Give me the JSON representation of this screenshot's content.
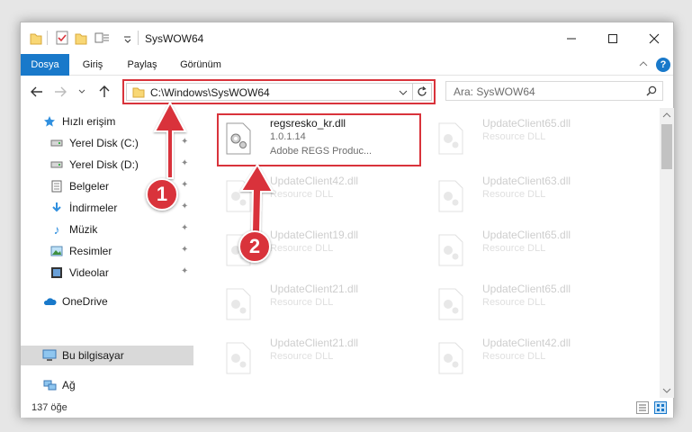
{
  "window": {
    "title": "SysWOW64",
    "minimize_icon": "minimize-icon",
    "maximize_icon": "maximize-icon",
    "close_icon": "close-icon"
  },
  "ribbon": {
    "tabs": [
      "Dosya",
      "Giriş",
      "Paylaş",
      "Görünüm"
    ],
    "active_tab_color": "#1979ca"
  },
  "nav": {
    "address": "C:\\Windows\\SysWOW64",
    "search_placeholder": "Ara: SysWOW64"
  },
  "sidebar": {
    "items": [
      {
        "label": "Hızlı erişim",
        "icon": "star-icon",
        "pinned": false
      },
      {
        "label": "Yerel Disk (C:)",
        "icon": "drive-icon",
        "pinned": true
      },
      {
        "label": "Yerel Disk (D:)",
        "icon": "drive-icon",
        "pinned": true
      },
      {
        "label": "Belgeler",
        "icon": "document-icon",
        "pinned": true
      },
      {
        "label": "İndirmeler",
        "icon": "download-icon",
        "pinned": true
      },
      {
        "label": "Müzik",
        "icon": "music-icon",
        "pinned": true
      },
      {
        "label": "Resimler",
        "icon": "pictures-icon",
        "pinned": true
      },
      {
        "label": "Videolar",
        "icon": "video-icon",
        "pinned": true
      },
      {
        "label": "OneDrive",
        "icon": "cloud-icon",
        "pinned": false
      },
      {
        "label": "Bu bilgisayar",
        "icon": "computer-icon",
        "pinned": false,
        "selected": true
      },
      {
        "label": "Ağ",
        "icon": "network-icon",
        "pinned": false
      }
    ]
  },
  "files": [
    {
      "name": "regsresko_kr.dll",
      "line2": "1.0.1.14",
      "line3": "Adobe REGS    Produc...",
      "highlight": true
    },
    {
      "name": "UpdateClient65.dll",
      "line2": "Resource DLL",
      "line3": ""
    },
    {
      "name": "UpdateClient42.dll",
      "line2": "Resource DLL",
      "line3": ""
    },
    {
      "name": "UpdateClient63.dll",
      "line2": "Resource DLL",
      "line3": ""
    },
    {
      "name": "UpdateClient19.dll",
      "line2": "Resource DLL",
      "line3": ""
    },
    {
      "name": "UpdateClient65.dll",
      "line2": "Resource DLL",
      "line3": ""
    },
    {
      "name": "UpdateClient21.dll",
      "line2": "Resource DLL",
      "line3": ""
    },
    {
      "name": "UpdateClient65.dll",
      "line2": "Resource DLL",
      "line3": ""
    },
    {
      "name": "UpdateClient21.dll",
      "line2": "Resource DLL",
      "line3": ""
    },
    {
      "name": "UpdateClient42.dll",
      "line2": "Resource DLL",
      "line3": ""
    }
  ],
  "status": {
    "item_count": "137 öğe"
  },
  "annotations": {
    "step1": "1",
    "step2": "2",
    "color": "#d9333b"
  }
}
